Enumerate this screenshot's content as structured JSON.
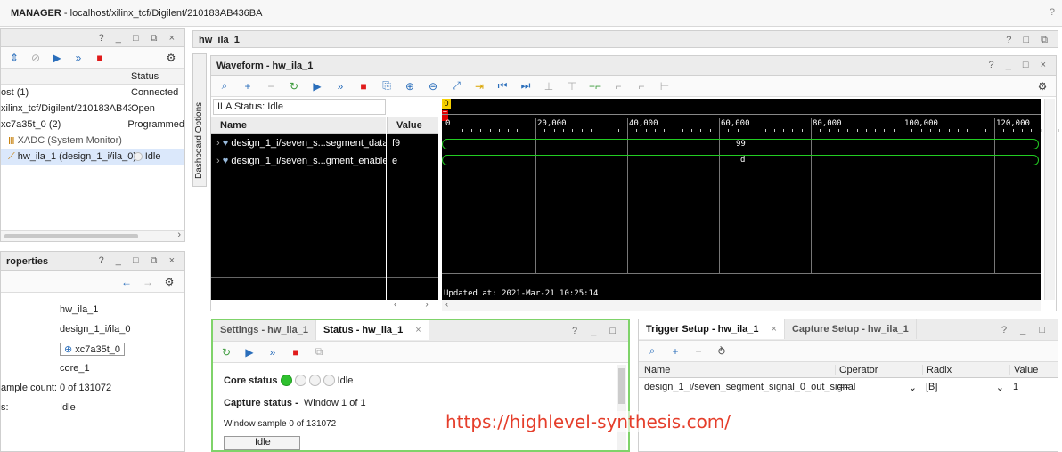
{
  "window": {
    "title_bold": "MANAGER",
    "title_path": " - localhost/xilinx_tcf/Digilent/210183AB436BA",
    "help": "?"
  },
  "hw_pane": {
    "controls": "? _ □ ⧉ ×",
    "column_status": "Status",
    "rows": [
      {
        "name": "ost (1)",
        "status": "Connected"
      },
      {
        "name": "xilinx_tcf/Digilent/210183AB436B",
        "status": "Open"
      },
      {
        "name": "xc7a35t_0 (2)",
        "status": "Programmed"
      },
      {
        "name": "XADC (System Monitor)",
        "status": ""
      },
      {
        "name": "hw_ila_1 (design_1_i/ila_0)",
        "status": "Idle"
      }
    ]
  },
  "properties": {
    "title": "roperties",
    "controls": "? _ □ ⧉ ×",
    "rows": [
      {
        "label": "",
        "value": "hw_ila_1"
      },
      {
        "label": "",
        "value": "design_1_i/ila_0"
      },
      {
        "label": "",
        "value": "xc7a35t_0"
      },
      {
        "label": "",
        "value": "core_1"
      },
      {
        "label": "ample count:",
        "value": "0 of 131072"
      },
      {
        "label": "s:",
        "value": "Idle"
      }
    ]
  },
  "dashboard_options": "Dashboard Options",
  "main": {
    "tab": "hw_ila_1",
    "controls": "? □ ⧉",
    "waveform": {
      "title": "Waveform - hw_ila_1",
      "controls": "? _ □ ×",
      "ila_status": "ILA Status: Idle",
      "col_name": "Name",
      "col_value": "Value",
      "signals": [
        {
          "name": "design_1_i/seven_s...segment_data[7:0]",
          "value": "f9",
          "bus": "99"
        },
        {
          "name": "design_1_i/seven_s...gment_enable[3:0]",
          "value": "e",
          "bus": "d"
        }
      ],
      "ticks": [
        "0",
        "20,000",
        "40,000",
        "60,000",
        "80,000",
        "100,000",
        "120,000"
      ],
      "marker_0": "0",
      "marker_t": "T",
      "updated": "Updated at: 2021-Mar-21 10:25:14"
    }
  },
  "bottom_left": {
    "tab_settings": "Settings - hw_ila_1",
    "tab_status": "Status - hw_ila_1",
    "controls": "? _ □",
    "core_status_label": "Core status",
    "core_status_value": "Idle",
    "capture_status": "Capture status -",
    "capture_window": "Window 1 of 1",
    "window_sample": "Window sample 0 of 131072",
    "idle_box": "Idle"
  },
  "bottom_right": {
    "tab_trigger": "Trigger Setup - hw_ila_1",
    "tab_capture": "Capture Setup - hw_ila_1",
    "controls": "? _ □",
    "columns": [
      "Name",
      "Operator",
      "Radix",
      "Value"
    ],
    "row": {
      "name": "design_1_i/seven_segment_signal_0_out_signal",
      "operator": "==",
      "radix": "[B]",
      "value": "1"
    }
  },
  "watermark": "https://highlevel-synthesis.com/",
  "colors": {
    "accent": "#2a6ebb",
    "stop": "#e01b1b",
    "wave_bg": "#000000",
    "bus": "#22cc22",
    "active_border": "#7fd36a"
  }
}
